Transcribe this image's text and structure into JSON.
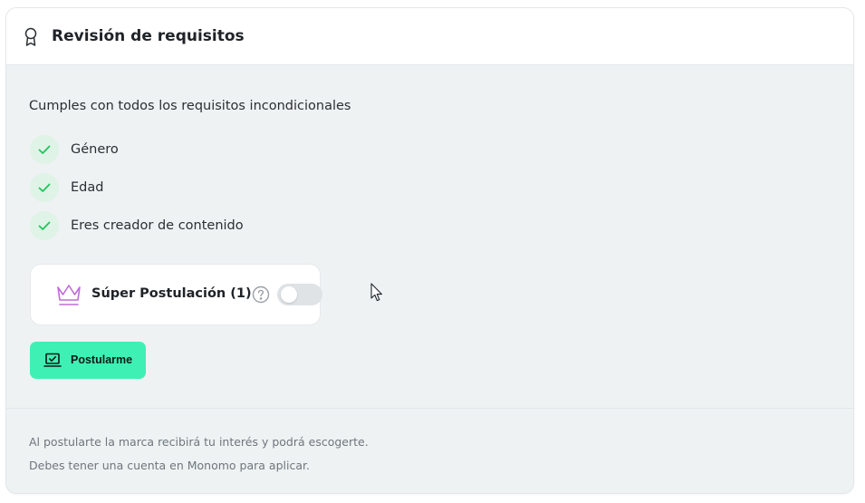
{
  "header": {
    "icon": "ribbon-award-icon",
    "title": "Revisión de requisitos"
  },
  "requirements": {
    "intro": "Cumples con todos los requisitos incondicionales",
    "items": [
      {
        "label": "Género",
        "icon": "check-icon",
        "status": "met"
      },
      {
        "label": "Edad",
        "icon": "check-icon",
        "status": "met"
      },
      {
        "label": "Eres creador de contenido",
        "icon": "check-icon",
        "status": "met"
      }
    ]
  },
  "super_application": {
    "icon": "crown-icon",
    "label": "Súper Postulación (1)",
    "help_icon": "question-circle-icon",
    "toggle_on": false
  },
  "apply_button": {
    "icon": "laptop-check-icon",
    "label": "Postularme"
  },
  "footer": {
    "line1": "Al postularte la marca recibirá tu interés y podrá escogerte.",
    "line2": "Debes tener una cuenta en Monomo para aplicar."
  },
  "colors": {
    "accent": "#3ff0b4",
    "check": "#22c55e",
    "check_bg": "#dff3e6",
    "crown": "#c06bd8",
    "panel_bg": "#eef2f3"
  }
}
